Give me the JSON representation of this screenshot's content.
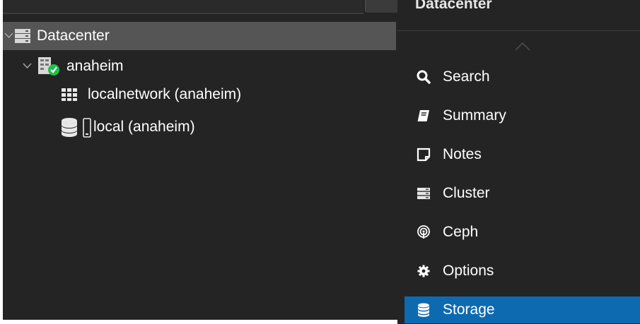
{
  "tree": {
    "nodes": [
      {
        "label": "Datacenter",
        "icon": "datacenter-icon",
        "selected": true,
        "expanded": true
      },
      {
        "label": "anaheim",
        "icon": "node-online-icon",
        "expanded": true
      },
      {
        "label": "localnetwork (anaheim)",
        "icon": "network-grid-icon"
      },
      {
        "label": "local (anaheim)",
        "icon": "storage-icon"
      }
    ]
  },
  "menu": {
    "header_title": "Datacenter",
    "items": [
      {
        "label": "Search",
        "icon": "search-icon"
      },
      {
        "label": "Summary",
        "icon": "book-icon"
      },
      {
        "label": "Notes",
        "icon": "note-icon"
      },
      {
        "label": "Cluster",
        "icon": "server-icon"
      },
      {
        "label": "Ceph",
        "icon": "ceph-icon"
      },
      {
        "label": "Options",
        "icon": "gear-icon"
      },
      {
        "label": "Storage",
        "icon": "database-icon",
        "active": true
      }
    ]
  },
  "colors": {
    "panel_bg": "#242424",
    "selected_row": "#555555",
    "active_item": "#0e6ab0",
    "online_green": "#21bf4b"
  }
}
